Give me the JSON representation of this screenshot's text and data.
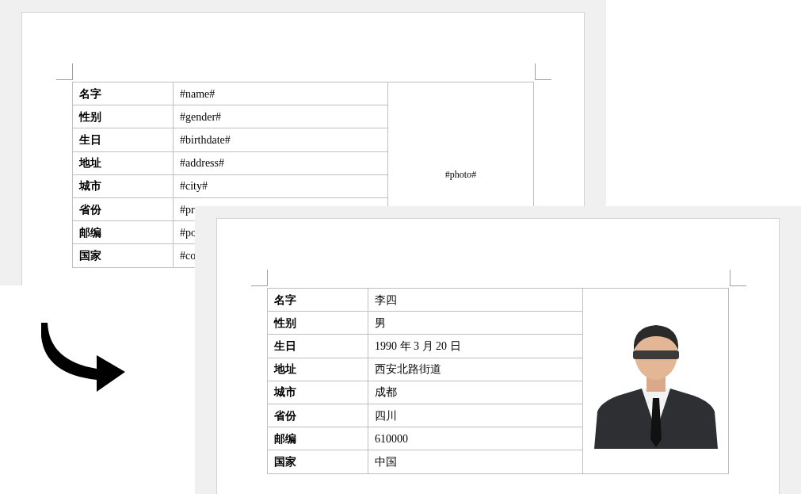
{
  "documents": [
    {
      "rows": [
        {
          "label": "名字",
          "value": "#name#"
        },
        {
          "label": "性别",
          "value": "#gender#"
        },
        {
          "label": "生日",
          "value": "#birthdate#"
        },
        {
          "label": "地址",
          "value": "#address#"
        },
        {
          "label": "城市",
          "value": "#city#"
        },
        {
          "label": "省份",
          "value": "#pr"
        },
        {
          "label": "邮编",
          "value": "#po"
        },
        {
          "label": "国家",
          "value": "#co"
        }
      ],
      "photo": {
        "kind": "text",
        "text": "#photo#"
      }
    },
    {
      "rows": [
        {
          "label": "名字",
          "value": "李四"
        },
        {
          "label": "性别",
          "value": "男"
        },
        {
          "label": "生日",
          "value": "1990 年 3 月 20 日"
        },
        {
          "label": "地址",
          "value": "西安北路街道"
        },
        {
          "label": "城市",
          "value": "成都"
        },
        {
          "label": "省份",
          "value": "四川"
        },
        {
          "label": "邮编",
          "value": "610000"
        },
        {
          "label": "国家",
          "value": "中国"
        }
      ]
    }
  ]
}
